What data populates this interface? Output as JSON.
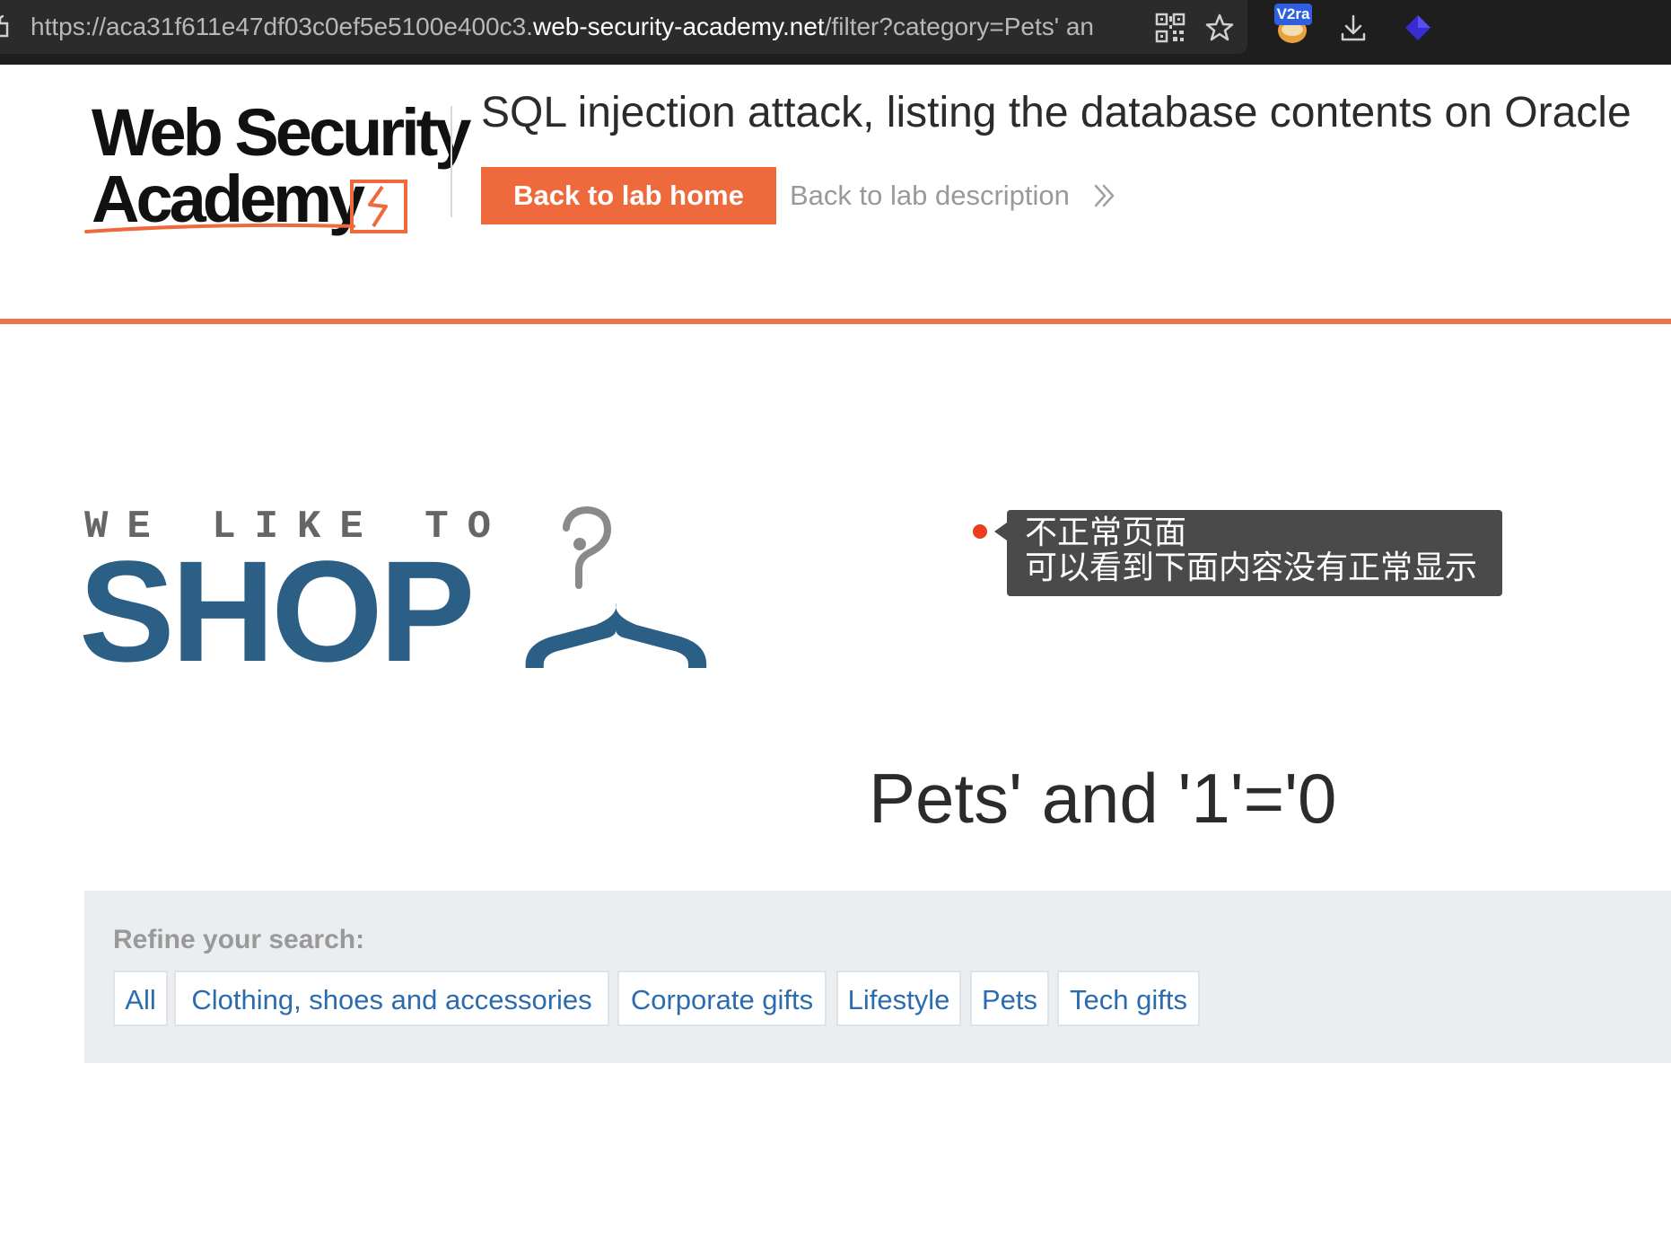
{
  "browser": {
    "url_prefix": "https://aca31f611e47df03c0ef5e5100e400c3.",
    "url_host": "web-security-academy.net",
    "url_path": "/filter?category=Pets' an",
    "extension_badge": "V2ra"
  },
  "academy": {
    "logo_line1": "Web Security",
    "logo_line2": "Academy",
    "lab_title": "SQL injection attack, listing the database contents on Oracle",
    "back_home_label": "Back to lab home",
    "back_description_label": "Back to lab description",
    "accent_color": "#ee6a3c"
  },
  "shop": {
    "tagline": "WE LIKE TO",
    "wordmark": "SHOP",
    "brand_color": "#2c5f85"
  },
  "annotation": {
    "line1": "不正常页面",
    "line2": "可以看到下面内容没有正常显示"
  },
  "main": {
    "heading": "Pets' and '1'='0"
  },
  "refine": {
    "label": "Refine your search:",
    "filters": [
      "All",
      "Clothing, shoes and accessories",
      "Corporate gifts",
      "Lifestyle",
      "Pets",
      "Tech gifts"
    ]
  },
  "icons": [
    "lock-icon",
    "qr-code-icon",
    "bookmark-star-icon",
    "v2ray-extension-icon",
    "download-icon",
    "extension-diamond-icon",
    "chevron-double-right-icon",
    "hanger-icon"
  ]
}
